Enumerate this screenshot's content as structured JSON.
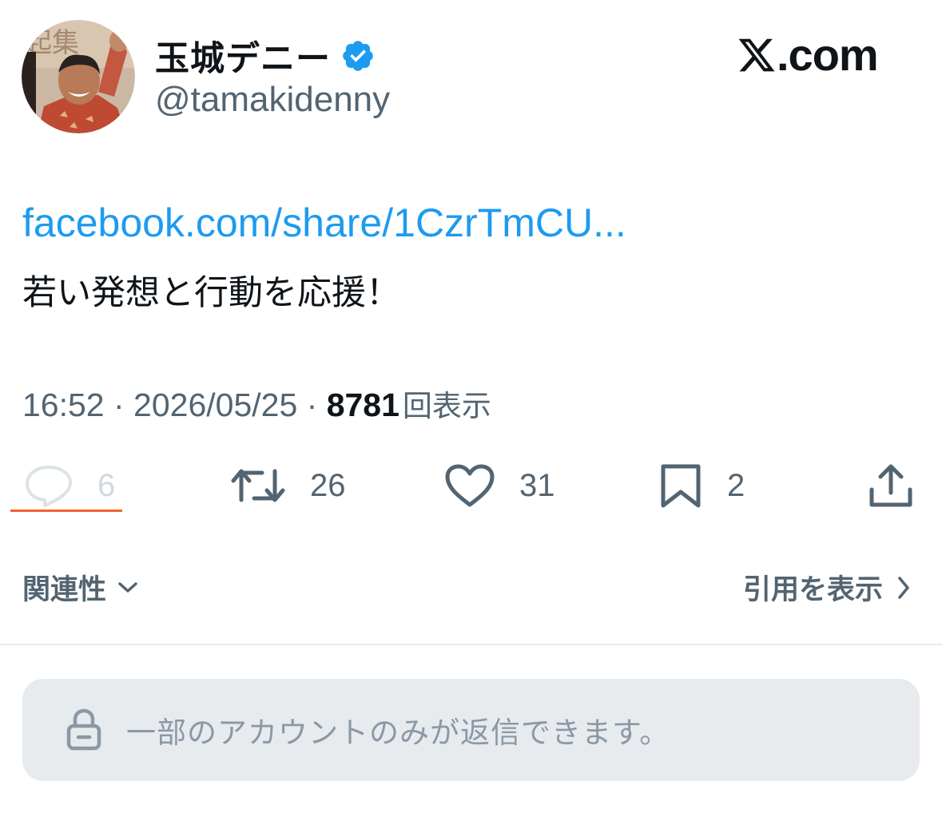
{
  "author": {
    "display_name": "玉城デニー",
    "handle": "@tamakidenny",
    "verified": true,
    "avatar_icon": "profile-photo"
  },
  "brand": {
    "label": ".com",
    "logo_icon": "x-logo-icon"
  },
  "tweet": {
    "link_text": "facebook.com/share/1CzrTmCU...",
    "text": "若い発想と行動を応援！",
    "time": "16:52",
    "date": "2026/05/25",
    "separator": " · ",
    "views_count": "8781",
    "views_label": "回表示"
  },
  "actions": {
    "reply_count": "6",
    "repost_count": "26",
    "like_count": "31",
    "bookmark_count": "2"
  },
  "footer": {
    "relevance_label": "関連性",
    "quotes_label": "引用を表示",
    "reply_restriction": "一部のアカウントのみが返信できます。"
  },
  "colors": {
    "link": "#1d9bf0",
    "muted": "#536471",
    "text": "#0f1419",
    "verified_badge": "#1d9bf0",
    "reply_underline": "#f4622f",
    "restriction_bg": "#e7ebee"
  }
}
